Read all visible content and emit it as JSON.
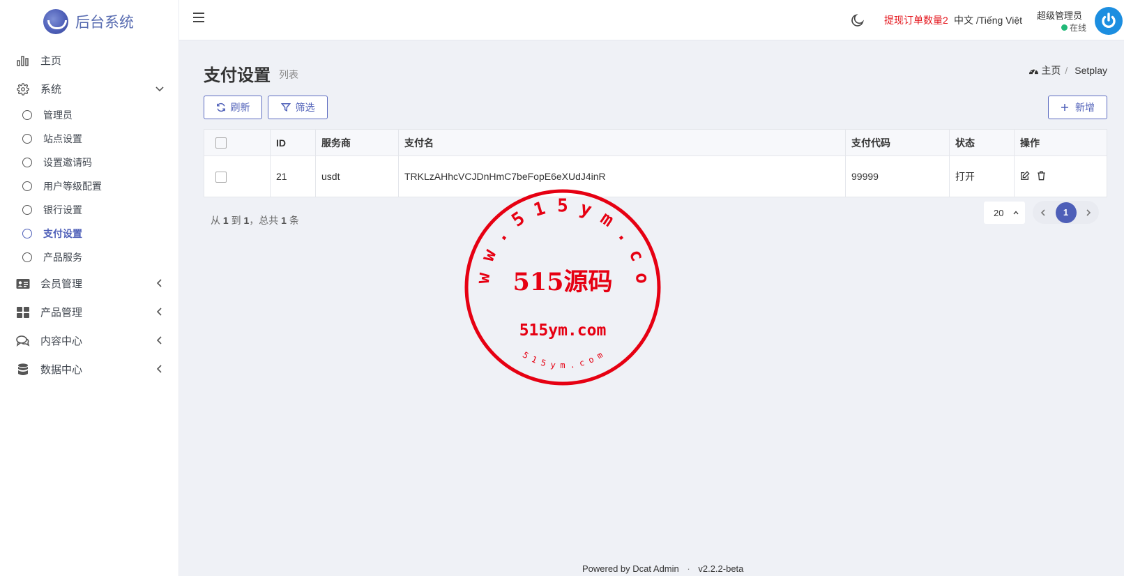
{
  "brand": {
    "name": "后台系统"
  },
  "sidebar": {
    "items": [
      {
        "label": "主页",
        "icon": "bar-chart-icon"
      },
      {
        "label": "系统",
        "icon": "gear-icon",
        "expanded": true,
        "children": [
          {
            "label": "管理员"
          },
          {
            "label": "站点设置"
          },
          {
            "label": "设置邀请码"
          },
          {
            "label": "用户等级配置"
          },
          {
            "label": "银行设置"
          },
          {
            "label": "支付设置",
            "active": true
          },
          {
            "label": "产品服务"
          }
        ]
      },
      {
        "label": "会员管理",
        "icon": "id-card-icon"
      },
      {
        "label": "产品管理",
        "icon": "grid-icon"
      },
      {
        "label": "内容中心",
        "icon": "comments-icon"
      },
      {
        "label": "数据中心",
        "icon": "database-icon"
      }
    ]
  },
  "topbar": {
    "withdraw_notice": "提现订单数量2",
    "language": "中文 /Tiếng Việt",
    "user_name": "超级管理员",
    "user_status": "在线"
  },
  "page": {
    "title": "支付设置",
    "subtitle": "列表",
    "breadcrumb": {
      "home": "主页",
      "current": "Setplay"
    }
  },
  "toolbar": {
    "refresh_label": "刷新",
    "filter_label": "筛选",
    "new_label": "新增"
  },
  "table": {
    "headers": [
      "ID",
      "服务商",
      "支付名",
      "支付代码",
      "状态",
      "操作"
    ],
    "rows": [
      {
        "id": "21",
        "provider": "usdt",
        "name": "TRKLzAHhcVCJDnHmC7beFopE6eXUdJ4inR",
        "code": "99999",
        "status": "打开"
      }
    ]
  },
  "pagination": {
    "summary_prefix": "从",
    "from": "1",
    "summary_to": "到",
    "to": "1",
    "summary_total": "，总共",
    "total": "1",
    "summary_unit": "条",
    "per_page": "20",
    "current_page": "1"
  },
  "footer": {
    "powered_by": "Powered by",
    "product": "Dcat Admin",
    "version": "v2.2.2-beta"
  },
  "watermark": {
    "top_ring": "w w w . 5 1 5 y m . c o m",
    "center_main": "515源码",
    "center_sub": "515ym.com",
    "bottom_ring": "5 1 5 y m . c o m"
  },
  "colors": {
    "accent": "#4e5fb8",
    "danger": "#e4141b",
    "online": "#21b978",
    "stamp": "#e60012"
  }
}
